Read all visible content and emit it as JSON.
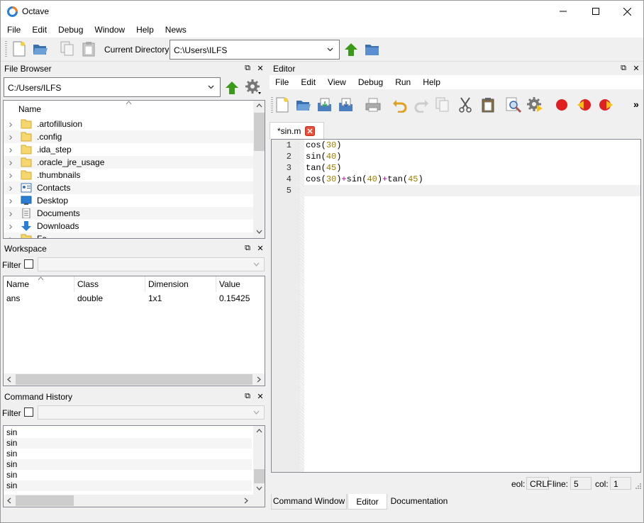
{
  "window": {
    "title": "Octave"
  },
  "menubar": {
    "items": [
      "File",
      "Edit",
      "Debug",
      "Window",
      "Help",
      "News"
    ]
  },
  "toolbar": {
    "current_directory_label": "Current Directory:",
    "current_directory_value": "C:\\Users\\ILFS"
  },
  "file_browser": {
    "title": "File Browser",
    "path": "C:/Users/ILFS",
    "column_header": "Name",
    "items": [
      {
        "name": ".artofillusion",
        "icon": "folder-icon"
      },
      {
        "name": ".config",
        "icon": "folder-icon"
      },
      {
        "name": ".ida_step",
        "icon": "folder-icon"
      },
      {
        "name": ".oracle_jre_usage",
        "icon": "folder-icon"
      },
      {
        "name": ".thumbnails",
        "icon": "folder-icon"
      },
      {
        "name": "Contacts",
        "icon": "contacts-icon"
      },
      {
        "name": "Desktop",
        "icon": "desktop-icon"
      },
      {
        "name": "Documents",
        "icon": "documents-icon"
      },
      {
        "name": "Downloads",
        "icon": "downloads-icon"
      },
      {
        "name": "Fa...",
        "icon": "folder-icon"
      }
    ]
  },
  "workspace": {
    "title": "Workspace",
    "filter_label": "Filter",
    "columns": [
      "Name",
      "Class",
      "Dimension",
      "Value"
    ],
    "rows": [
      [
        "ans",
        "double",
        "1x1",
        "0.15425"
      ]
    ]
  },
  "command_history": {
    "title": "Command History",
    "filter_label": "Filter",
    "items": [
      "sin",
      "sin",
      "sin",
      "sin",
      "sin",
      "sin"
    ]
  },
  "editor": {
    "title": "Editor",
    "menu": [
      "File",
      "Edit",
      "View",
      "Debug",
      "Run",
      "Help"
    ],
    "tab_label": "*sin.m",
    "lines": [
      {
        "n": "1",
        "tokens": [
          [
            "t",
            "cos"
          ],
          [
            "o",
            "("
          ],
          [
            "n",
            "30"
          ],
          [
            "o",
            ")"
          ]
        ]
      },
      {
        "n": "2",
        "tokens": [
          [
            "t",
            "sin"
          ],
          [
            "o",
            "("
          ],
          [
            "n",
            "40"
          ],
          [
            "o",
            ")"
          ]
        ]
      },
      {
        "n": "3",
        "tokens": [
          [
            "t",
            "tan"
          ],
          [
            "o",
            "("
          ],
          [
            "n",
            "45"
          ],
          [
            "o",
            ")"
          ]
        ]
      },
      {
        "n": "4",
        "tokens": [
          [
            "t",
            "cos"
          ],
          [
            "o",
            "("
          ],
          [
            "n",
            "30"
          ],
          [
            "o",
            ")"
          ],
          [
            "p",
            "+"
          ],
          [
            "t",
            "sin"
          ],
          [
            "o",
            "("
          ],
          [
            "n",
            "40"
          ],
          [
            "o",
            ")"
          ],
          [
            "p",
            "+"
          ],
          [
            "t",
            "tan"
          ],
          [
            "o",
            "("
          ],
          [
            "n",
            "45"
          ],
          [
            "o",
            ")"
          ]
        ]
      },
      {
        "n": "5",
        "tokens": []
      }
    ],
    "status": {
      "eol_label": "eol:",
      "eol_value": "CRLF",
      "line_label": "line:",
      "line_value": "5",
      "col_label": "col:",
      "col_value": "1"
    }
  },
  "bottom_tabs": [
    "Command Window",
    "Editor",
    "Documentation"
  ],
  "colors": {
    "number": "#a08000",
    "operator": "#a000a0",
    "folder": "#f5d76e",
    "accent_green": "#3a9a1a",
    "breakpoint_red": "#e02020"
  }
}
